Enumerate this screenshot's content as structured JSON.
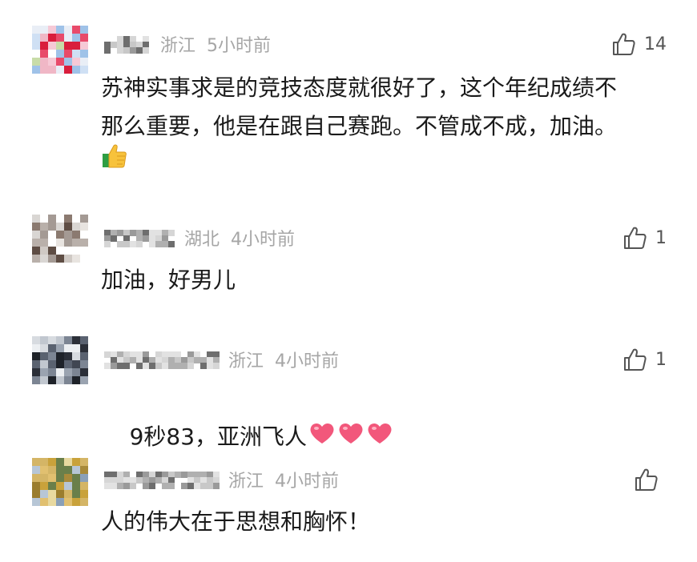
{
  "comments": [
    {
      "location": "浙江",
      "time": "5小时前",
      "likes": "14",
      "text": "苏神实事求是的竞技态度就很好了，这个年纪成绩不\n那么重要，他是在跟自己赛跑。不管成不成，加油。",
      "emoji": "thumbs-up-emoji"
    },
    {
      "location": "湖北",
      "time": "4小时前",
      "likes": "1",
      "text": "加油，好男儿"
    },
    {
      "location": "浙江",
      "time": "4小时前",
      "likes": "1",
      "text": "9秒83，亚洲飞人",
      "emoji": "heart-emoji x3"
    },
    {
      "location": "浙江",
      "time": "4小时前",
      "likes": "",
      "text": "人的伟大在于思想和胸怀！"
    }
  ],
  "colors": {
    "meta_gray": "#a6a6a6",
    "heart_pink": "#f2577b",
    "thumb_yellow": "#f7c23b",
    "thumb_green": "#2e9e43"
  }
}
